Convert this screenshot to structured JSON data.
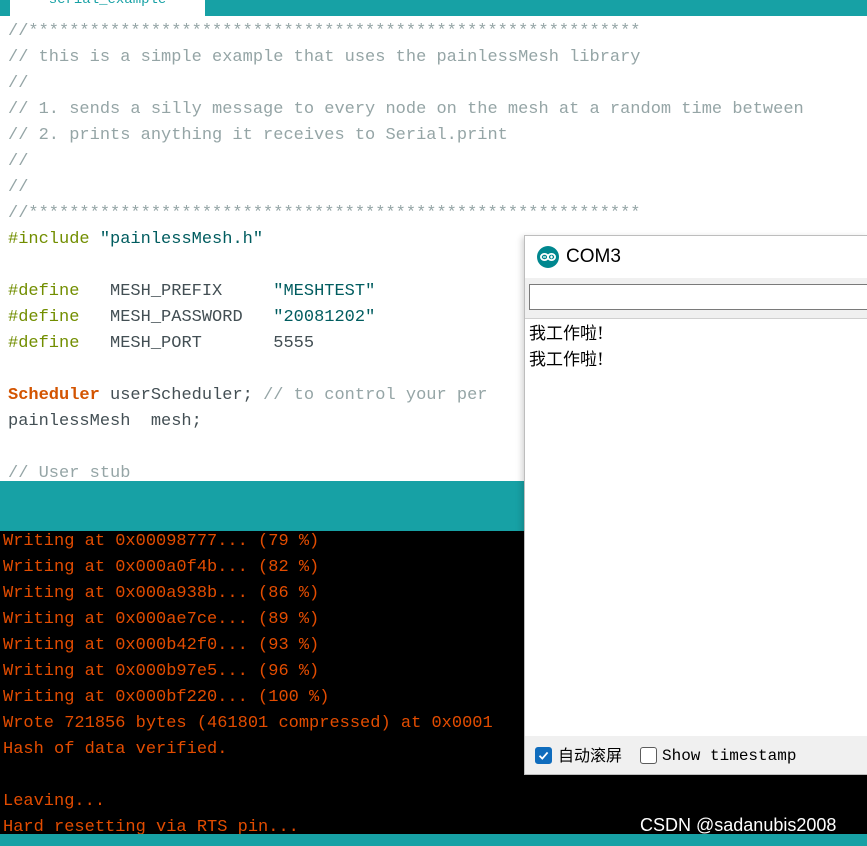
{
  "tab": {
    "label": "serial_example"
  },
  "editor": {
    "lines": [
      {
        "parts": [
          {
            "cls": "c-comment",
            "text": "//************************************************************"
          }
        ]
      },
      {
        "parts": [
          {
            "cls": "c-comment",
            "text": "// this is a simple example that uses the painlessMesh library"
          }
        ]
      },
      {
        "parts": [
          {
            "cls": "c-comment",
            "text": "//"
          }
        ]
      },
      {
        "parts": [
          {
            "cls": "c-comment",
            "text": "// 1. sends a silly message to every node on the mesh at a random time between"
          }
        ]
      },
      {
        "parts": [
          {
            "cls": "c-comment",
            "text": "// 2. prints anything it receives to Serial.print"
          }
        ]
      },
      {
        "parts": [
          {
            "cls": "c-comment",
            "text": "//"
          }
        ]
      },
      {
        "parts": [
          {
            "cls": "c-comment",
            "text": "//"
          }
        ]
      },
      {
        "parts": [
          {
            "cls": "c-comment",
            "text": "//************************************************************"
          }
        ]
      },
      {
        "parts": [
          {
            "cls": "c-kw",
            "text": "#include "
          },
          {
            "cls": "c-str",
            "text": "\"painlessMesh.h\""
          }
        ]
      },
      {
        "parts": []
      },
      {
        "parts": [
          {
            "cls": "c-kw",
            "text": "#define"
          },
          {
            "cls": "c-plain",
            "text": "   MESH_PREFIX     "
          },
          {
            "cls": "c-str",
            "text": "\"MESHTEST\""
          }
        ]
      },
      {
        "parts": [
          {
            "cls": "c-kw",
            "text": "#define"
          },
          {
            "cls": "c-plain",
            "text": "   MESH_PASSWORD   "
          },
          {
            "cls": "c-str",
            "text": "\"20081202\""
          }
        ]
      },
      {
        "parts": [
          {
            "cls": "c-kw",
            "text": "#define"
          },
          {
            "cls": "c-plain",
            "text": "   MESH_PORT       5555"
          }
        ]
      },
      {
        "parts": []
      },
      {
        "parts": [
          {
            "cls": "c-type",
            "text": "Scheduler"
          },
          {
            "cls": "c-plain",
            "text": " userScheduler; "
          },
          {
            "cls": "c-comment",
            "text": "// to control your per"
          }
        ]
      },
      {
        "parts": [
          {
            "cls": "c-plain",
            "text": "painlessMesh  mesh;"
          }
        ]
      },
      {
        "parts": []
      },
      {
        "parts": [
          {
            "cls": "c-comment",
            "text": "// User stub"
          }
        ]
      }
    ]
  },
  "console": {
    "lines": [
      "Writing at 0x00098777... (79 %)",
      "Writing at 0x000a0f4b... (82 %)",
      "Writing at 0x000a938b... (86 %)",
      "Writing at 0x000ae7ce... (89 %)",
      "Writing at 0x000b42f0... (93 %)",
      "Writing at 0x000b97e5... (96 %)",
      "Writing at 0x000bf220... (100 %)",
      "Wrote 721856 bytes (461801 compressed) at 0x0001",
      "Hash of data verified.",
      "",
      "Leaving...",
      "Hard resetting via RTS pin..."
    ]
  },
  "watermark": "CSDN @sadanubis2008",
  "monitor": {
    "title": "COM3",
    "input_value": "",
    "output": [
      "我工作啦!",
      "我工作啦!"
    ],
    "autoscroll_label": "自动滚屏",
    "autoscroll_checked": true,
    "timestamp_label": "Show timestamp",
    "timestamp_checked": false,
    "colors": {
      "logo": "#00878f",
      "accent": "#17a1a5",
      "checkbox": "#0f6cbd"
    },
    "icons": {
      "logo": "arduino-logo-icon",
      "check": "checkmark-icon"
    }
  }
}
